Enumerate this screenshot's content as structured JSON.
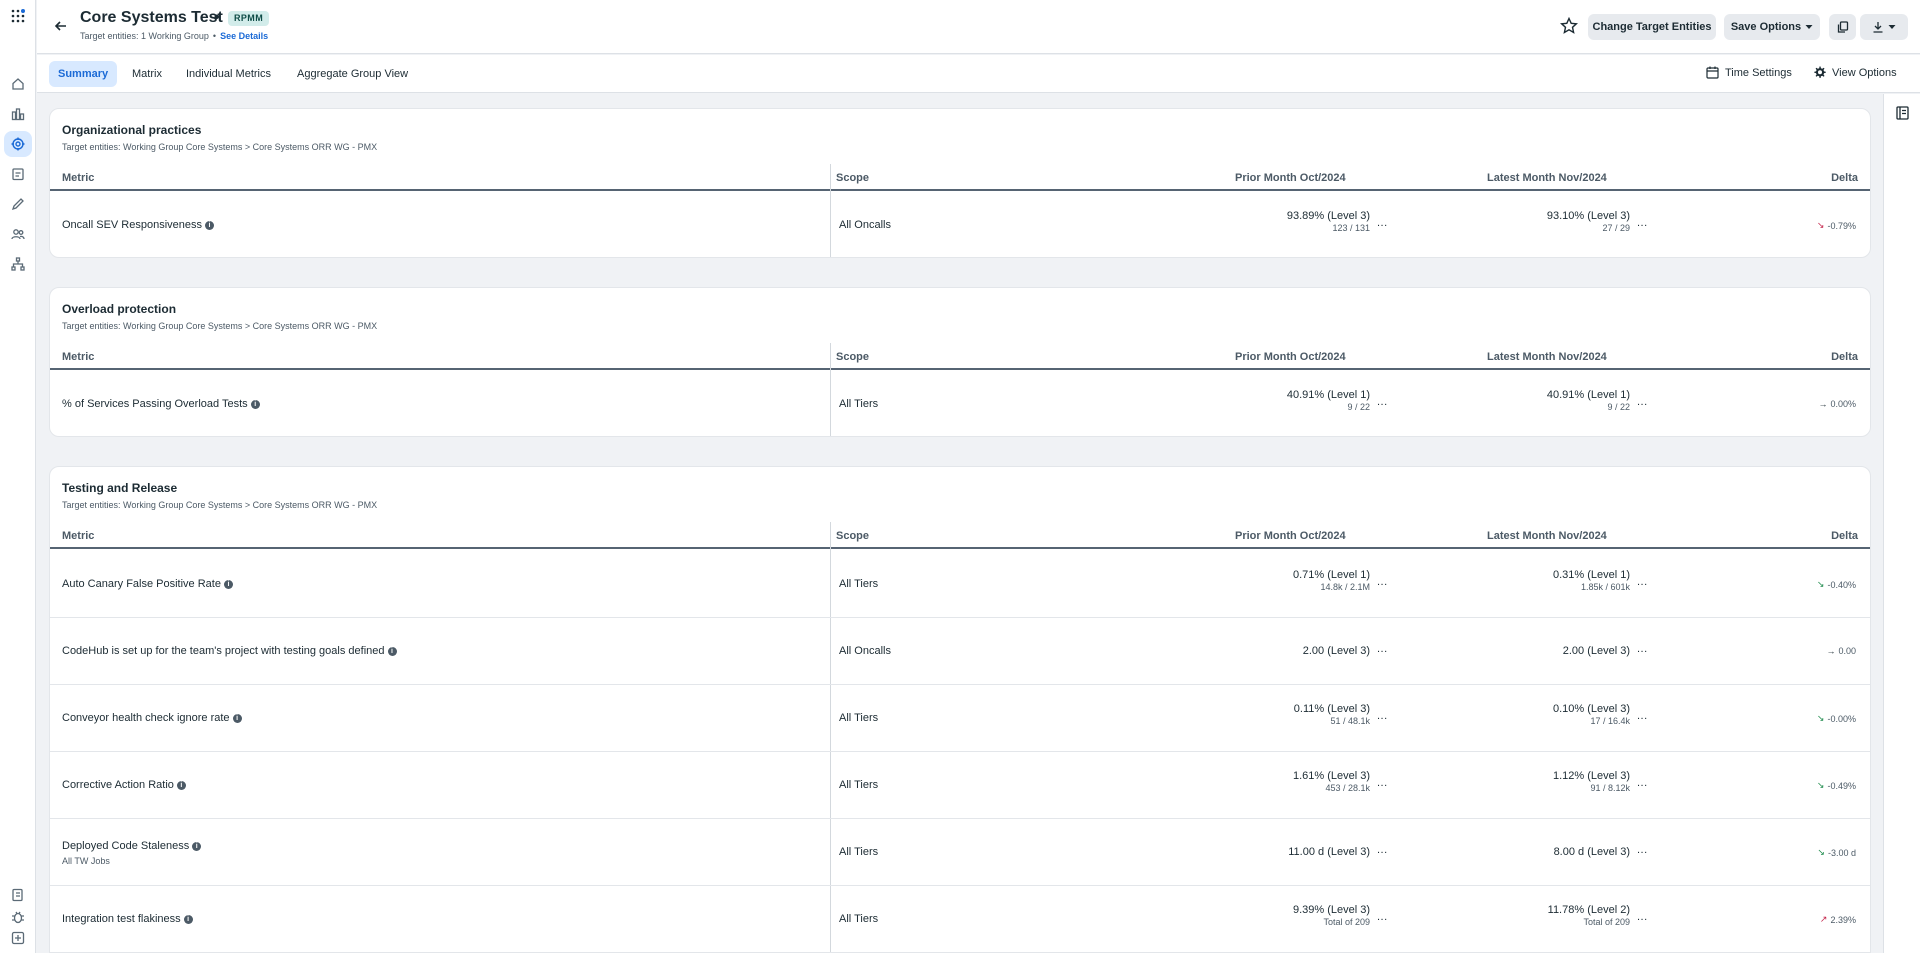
{
  "header": {
    "title": "Core Systems Test",
    "title_dot": "•",
    "badge": "RPMM",
    "subtitle": "Target entities: 1 Working Group",
    "subtitle_sep": "•",
    "see_details": "See Details",
    "change_target": "Change Target Entities",
    "save_options": "Save Options"
  },
  "tabs": [
    {
      "label": "Summary",
      "active": true
    },
    {
      "label": "Matrix"
    },
    {
      "label": "Individual Metrics"
    },
    {
      "label": "Aggregate Group View"
    }
  ],
  "toolbar": {
    "time_settings": "Time Settings",
    "view_options": "View Options"
  },
  "columns": {
    "metric": "Metric",
    "scope": "Scope",
    "prior": "Prior Month Oct/2024",
    "latest": "Latest Month Nov/2024",
    "delta": "Delta"
  },
  "ellipsis": "...",
  "sections": [
    {
      "title": "Organizational practices",
      "subtitle": "Target entities: Working Group Core Systems > Core Systems ORR WG - PMX",
      "rows": [
        {
          "metric": "Oncall SEV Responsiveness",
          "scope": "All Oncalls",
          "prior": "93.89% (Level 3)",
          "prior_sub": "123 / 131",
          "latest": "93.10% (Level 3)",
          "latest_sub": "27 / 29",
          "delta": "-0.79%",
          "trend": "down-red"
        }
      ]
    },
    {
      "title": "Overload protection",
      "subtitle": "Target entities: Working Group Core Systems > Core Systems ORR WG - PMX",
      "rows": [
        {
          "metric": "% of Services Passing Overload Tests",
          "scope": "All Tiers",
          "prior": "40.91% (Level 1)",
          "prior_sub": "9 / 22",
          "latest": "40.91% (Level 1)",
          "latest_sub": "9 / 22",
          "delta": "0.00%",
          "trend": "flat"
        }
      ]
    },
    {
      "title": "Testing and Release",
      "subtitle": "Target entities: Working Group Core Systems > Core Systems ORR WG - PMX",
      "rows": [
        {
          "metric": "Auto Canary False Positive Rate",
          "scope": "All Tiers",
          "prior": "0.71% (Level 1)",
          "prior_sub": "14.8k / 2.1M",
          "latest": "0.31% (Level 1)",
          "latest_sub": "1.85k / 601k",
          "delta": "-0.40%",
          "trend": "down-green"
        },
        {
          "metric": "CodeHub is set up for the team's project with testing goals defined",
          "scope": "All Oncalls",
          "prior": "2.00 (Level 3)",
          "prior_sub": "",
          "latest": "2.00 (Level 3)",
          "latest_sub": "",
          "delta": "0.00",
          "trend": "flat"
        },
        {
          "metric": "Conveyor health check ignore rate",
          "scope": "All Tiers",
          "prior": "0.11% (Level 3)",
          "prior_sub": "51 / 48.1k",
          "latest": "0.10% (Level 3)",
          "latest_sub": "17 / 16.4k",
          "delta": "-0.00%",
          "trend": "down-green"
        },
        {
          "metric": "Corrective Action Ratio",
          "scope": "All Tiers",
          "prior": "1.61% (Level 3)",
          "prior_sub": "453 / 28.1k",
          "latest": "1.12% (Level 3)",
          "latest_sub": "91 / 8.12k",
          "delta": "-0.49%",
          "trend": "down-green"
        },
        {
          "metric": "Deployed Code Staleness",
          "metric_sub": "All TW Jobs",
          "scope": "All Tiers",
          "prior": "11.00 d (Level 3)",
          "prior_sub": "",
          "latest": "8.00 d (Level 3)",
          "latest_sub": "",
          "delta": "-3.00 d",
          "trend": "down-green"
        },
        {
          "metric": "Integration test flakiness",
          "scope": "All Tiers",
          "prior": "9.39% (Level 3)",
          "prior_sub": "Total of 209",
          "latest": "11.78% (Level 2)",
          "latest_sub": "Total of 209",
          "delta": "2.39%",
          "trend": "up-red"
        }
      ]
    }
  ]
}
